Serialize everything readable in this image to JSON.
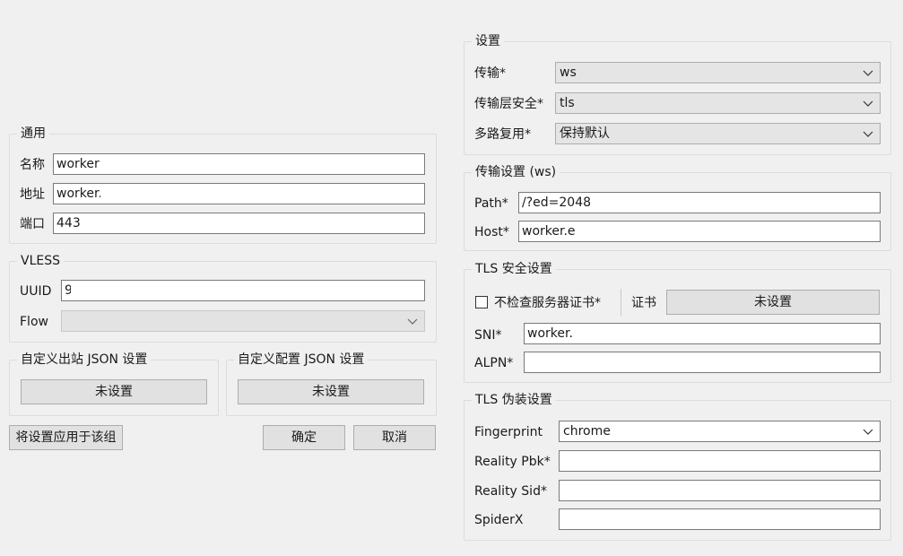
{
  "general": {
    "title": "通用",
    "name_label": "名称",
    "name_value": "worker",
    "address_label": "地址",
    "address_value": "worker.",
    "port_label": "端口",
    "port_value": "443"
  },
  "vless": {
    "title": "VLESS",
    "uuid_label": "UUID",
    "uuid_value": "9",
    "flow_label": "Flow",
    "flow_value": ""
  },
  "custom_outbound": {
    "title": "自定义出站 JSON 设置",
    "button": "未设置"
  },
  "custom_config": {
    "title": "自定义配置 JSON 设置",
    "button": "未设置"
  },
  "actions": {
    "apply_group": "将设置应用于该组",
    "ok": "确定",
    "cancel": "取消"
  },
  "settings": {
    "title": "设置",
    "transport_label": "传输*",
    "transport_value": "ws",
    "security_label": "传输层安全*",
    "security_value": "tls",
    "mux_label": "多路复用*",
    "mux_value": "保持默认"
  },
  "transport_settings": {
    "title": "传输设置 (ws)",
    "path_label": "Path*",
    "path_value": "/?ed=2048",
    "host_label": "Host*",
    "host_value": "worker.e"
  },
  "tls_settings": {
    "title": "TLS 安全设置",
    "skip_verify_label": "不检查服务器证书*",
    "cert_label": "证书",
    "cert_button": "未设置",
    "sni_label": "SNI*",
    "sni_value": "worker.",
    "alpn_label": "ALPN*",
    "alpn_value": ""
  },
  "tls_camouflage": {
    "title": "TLS 伪装设置",
    "fingerprint_label": "Fingerprint",
    "fingerprint_value": "chrome",
    "reality_pbk_label": "Reality Pbk*",
    "reality_pbk_value": "",
    "reality_sid_label": "Reality Sid*",
    "reality_sid_value": "",
    "spiderx_label": "SpiderX",
    "spiderx_value": ""
  }
}
